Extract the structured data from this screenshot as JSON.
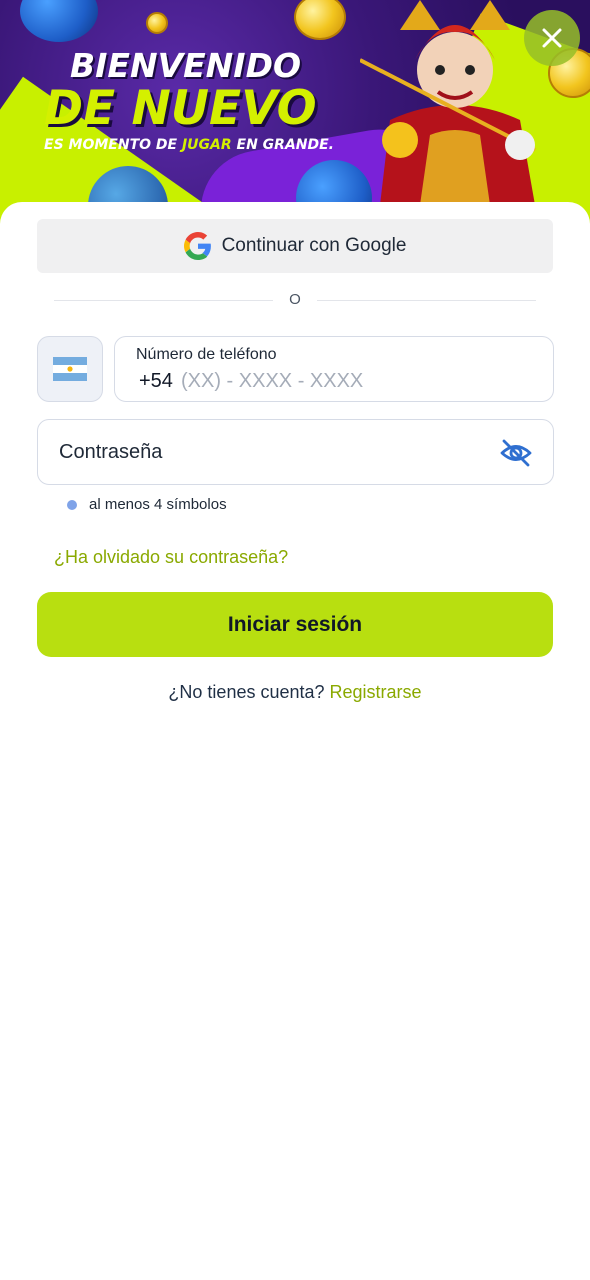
{
  "banner": {
    "line1": "BIENVENIDO",
    "line2": "DE NUEVO",
    "tagline_pre": "ES MOMENTO DE ",
    "tagline_highlight": "JUGAR",
    "tagline_post": " EN GRANDE."
  },
  "google_button": {
    "label": "Continuar con Google"
  },
  "divider": {
    "text": "O"
  },
  "phone": {
    "label": "Número de teléfono",
    "country_code": "+54",
    "placeholder": "(XX) - XXXX - XXXX",
    "country_flag": "argentina-flag-icon"
  },
  "password": {
    "placeholder": "Contraseña",
    "toggle_icon": "eye-slash-icon"
  },
  "hint": {
    "text": "al menos 4 símbolos"
  },
  "forgot": {
    "text": "¿Ha olvidado su contraseña?"
  },
  "login": {
    "label": "Iniciar sesión"
  },
  "register": {
    "question": "¿No tienes cuenta?",
    "link": "Registrarse"
  },
  "colors": {
    "accent": "#b8df10",
    "link": "#8aa900",
    "banner_bg": "#3a1778",
    "lime": "#c8f000"
  }
}
